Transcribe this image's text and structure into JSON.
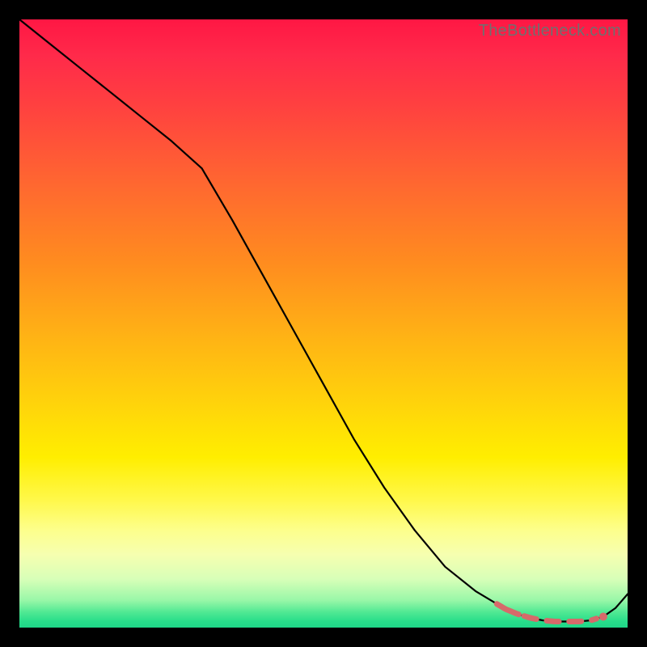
{
  "watermark": "TheBottleneck.com",
  "colors": {
    "curve": "#000000",
    "dots": "#d66a6a",
    "gradient_top": "#ff1744",
    "gradient_mid": "#ffee00",
    "gradient_bottom": "#1fd688"
  },
  "chart_data": {
    "type": "line",
    "title": "",
    "xlabel": "",
    "ylabel": "",
    "xlim": [
      0,
      100
    ],
    "ylim": [
      0,
      100
    ],
    "series": [
      {
        "name": "bottleneck-curve",
        "x": [
          0,
          5,
          10,
          15,
          20,
          25,
          30,
          35,
          40,
          45,
          50,
          55,
          60,
          65,
          70,
          75,
          80,
          82,
          84,
          86,
          88,
          90,
          92,
          94,
          96,
          98,
          100
        ],
        "y": [
          100,
          96,
          92,
          88,
          84,
          80,
          75.5,
          67,
          58,
          49,
          40,
          31,
          23,
          16,
          10,
          6,
          3,
          2.2,
          1.6,
          1.2,
          1.0,
          1.0,
          1.0,
          1.2,
          1.8,
          3.2,
          5.5
        ]
      }
    ],
    "highlight_range_x": [
      80,
      96
    ],
    "notes": "Heat-gradient background from red (top / worst) to green (bottom / best). Single black curve descending sharply; salmon dotted overlay marks the near-minimum flat region."
  }
}
